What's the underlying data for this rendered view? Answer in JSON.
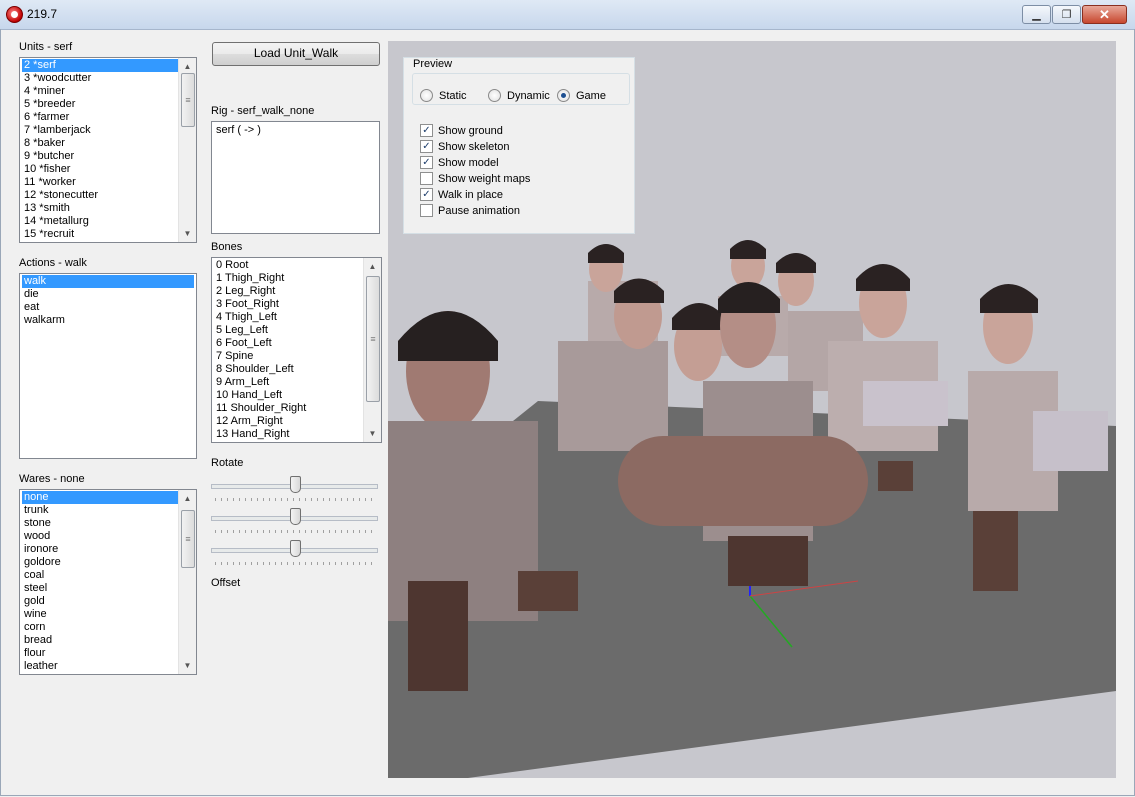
{
  "window": {
    "title": "219.7",
    "min_glyph": "▁",
    "max_glyph": "❐",
    "close_glyph": "✕"
  },
  "units": {
    "label": "Units - serf",
    "items": [
      "2 *serf",
      "3 *woodcutter",
      "4 *miner",
      "5 *breeder",
      "6 *farmer",
      "7 *lamberjack",
      "8 *baker",
      "9 *butcher",
      "10 *fisher",
      "11 *worker",
      "12 *stonecutter",
      "13 *smith",
      "14 *metallurg",
      "15 *recruit"
    ],
    "selected": 0
  },
  "actions": {
    "label": "Actions - walk",
    "items": [
      "walk",
      "die",
      "eat",
      "walkarm"
    ],
    "selected": 0
  },
  "wares": {
    "label": "Wares - none",
    "items": [
      "none",
      "trunk",
      "stone",
      "wood",
      "ironore",
      "goldore",
      "coal",
      "steel",
      "gold",
      "wine",
      "corn",
      "bread",
      "flour",
      "leather"
    ],
    "selected": 0
  },
  "load_button": "Load Unit_Walk",
  "rig": {
    "label": "Rig - serf_walk_none",
    "text": "serf ( -> )"
  },
  "bones": {
    "label": "Bones",
    "items": [
      "0 Root",
      "1 Thigh_Right",
      "2 Leg_Right",
      "3 Foot_Right",
      "4 Thigh_Left",
      "5 Leg_Left",
      "6 Foot_Left",
      "7 Spine",
      "8 Shoulder_Left",
      "9 Arm_Left",
      "10 Hand_Left",
      "11 Shoulder_Right",
      "12 Arm_Right",
      "13 Hand_Right"
    ]
  },
  "rotate_label": "Rotate",
  "offset_label": "Offset",
  "preview": {
    "title": "Preview",
    "modes": [
      {
        "label": "Static",
        "checked": false
      },
      {
        "label": "Dynamic",
        "checked": false
      },
      {
        "label": "Game",
        "checked": true
      }
    ],
    "options": [
      {
        "label": "Show ground",
        "checked": true
      },
      {
        "label": "Show skeleton",
        "checked": true
      },
      {
        "label": "Show model",
        "checked": true
      },
      {
        "label": "Show weight maps",
        "checked": false
      },
      {
        "label": "Walk in place",
        "checked": true
      },
      {
        "label": "Pause animation",
        "checked": false
      }
    ]
  },
  "colors": {
    "viewport_bg": "#c7c7cd",
    "ground": "#6b6b6b",
    "selection": "#3399ff"
  }
}
